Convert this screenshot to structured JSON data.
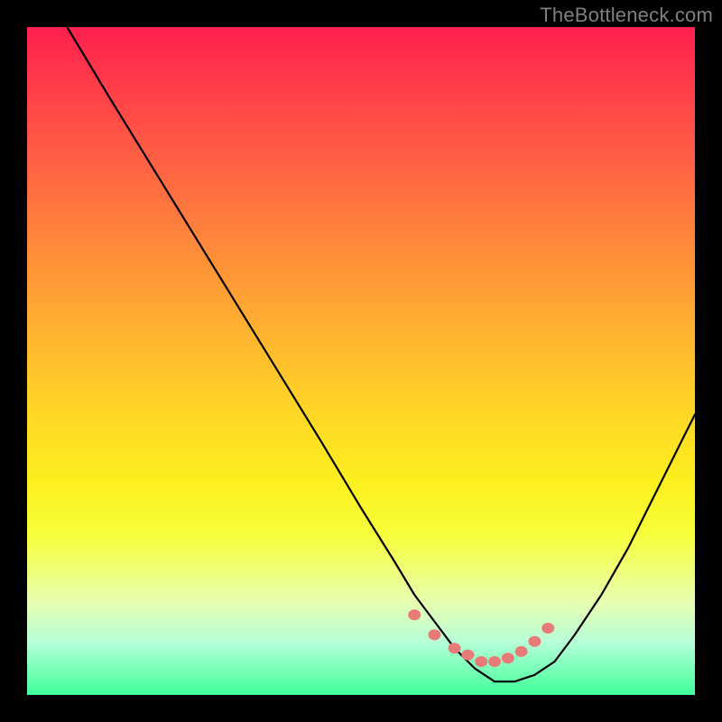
{
  "watermark": "TheBottleneck.com",
  "colors": {
    "marker": "#e87b78",
    "curve": "#000000",
    "frame": "#000000"
  },
  "chart_data": {
    "type": "line",
    "title": "",
    "xlabel": "",
    "ylabel": "",
    "xlim": [
      0,
      100
    ],
    "ylim": [
      0,
      100
    ],
    "grid": false,
    "legend": false,
    "series": [
      {
        "name": "bottleneck-curve",
        "x": [
          0,
          6,
          12,
          20,
          28,
          36,
          44,
          50,
          55,
          58,
          61,
          64,
          67,
          70,
          73,
          76,
          79,
          82,
          86,
          90,
          94,
          98,
          100
        ],
        "values": [
          115,
          100,
          90,
          77,
          64,
          51,
          38,
          28,
          20,
          15,
          11,
          7,
          4,
          2,
          2,
          3,
          5,
          9,
          15,
          22,
          30,
          38,
          42
        ]
      }
    ],
    "markers": {
      "name": "highlight-dots",
      "x": [
        58,
        61,
        64,
        66,
        68,
        70,
        72,
        74,
        76,
        78
      ],
      "values": [
        12,
        9,
        7,
        6,
        5,
        5,
        5.5,
        6.5,
        8,
        10
      ]
    }
  }
}
